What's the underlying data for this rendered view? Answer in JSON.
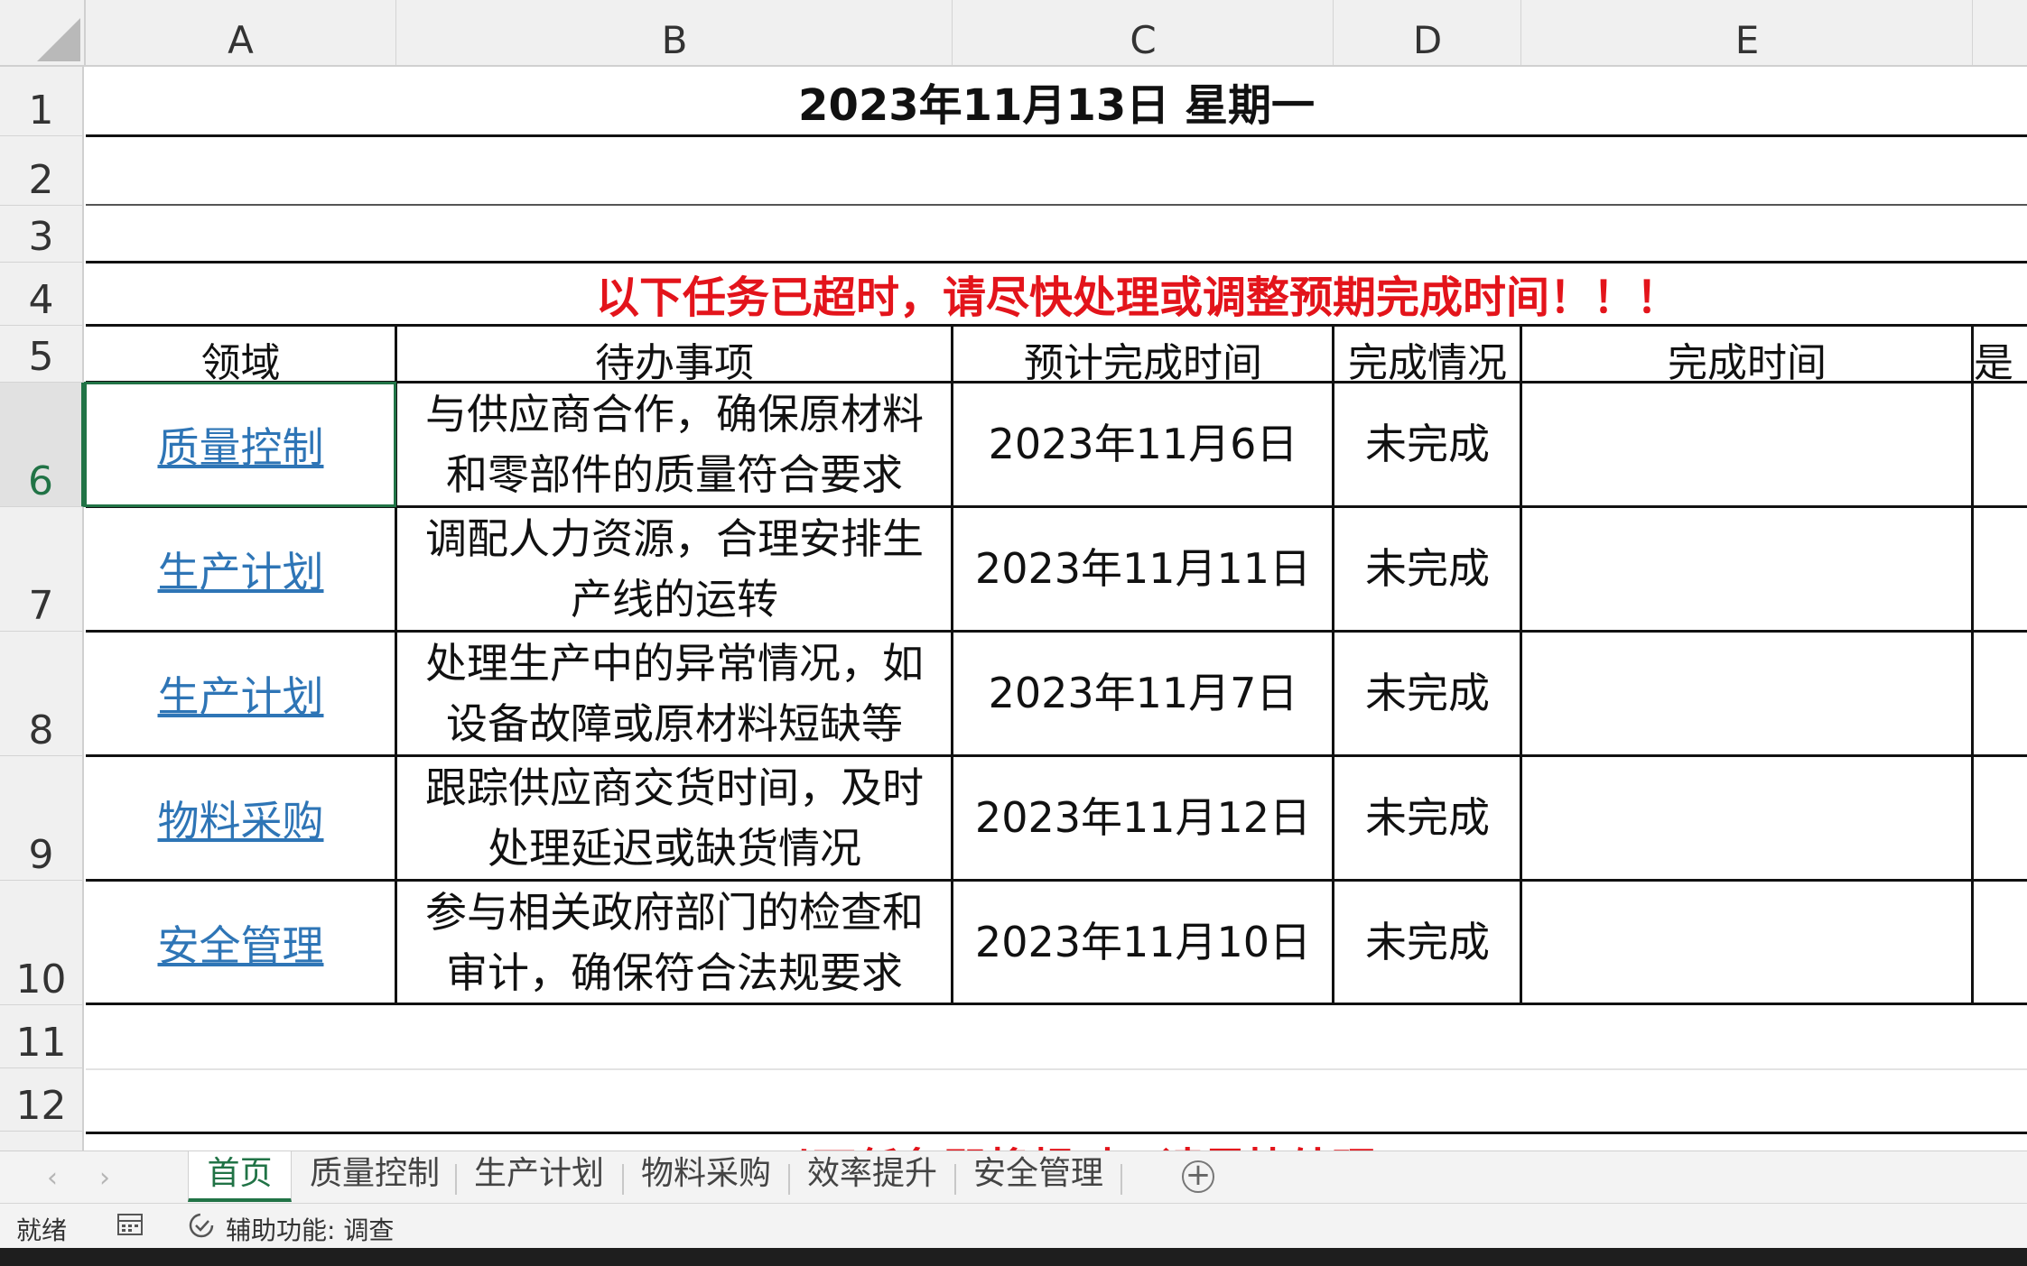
{
  "columns": [
    "A",
    "B",
    "C",
    "D",
    "E"
  ],
  "rows": [
    "1",
    "2",
    "3",
    "4",
    "5",
    "6",
    "7",
    "8",
    "9",
    "10",
    "11",
    "12"
  ],
  "sheet": {
    "title": "2023年11月13日 星期一",
    "alert": "以下任务已超时，请尽快处理或调整预期完成时间！！！",
    "headers": [
      "领域",
      "待办事项",
      "预计完成时间",
      "完成情况",
      "完成时间",
      "是"
    ],
    "tasks": [
      {
        "domain": "质量控制",
        "task_line1": "与供应商合作，确保原材料",
        "task_line2": "和零部件的质量符合要求",
        "due": "2023年11月6日",
        "status": "未完成"
      },
      {
        "domain": "生产计划",
        "task_line1": "调配人力资源，合理安排生",
        "task_line2": "产线的运转",
        "due": "2023年11月11日",
        "status": "未完成"
      },
      {
        "domain": "生产计划",
        "task_line1": "处理生产中的异常情况，如",
        "task_line2": "设备故障或原材料短缺等",
        "due": "2023年11月7日",
        "status": "未完成"
      },
      {
        "domain": "物料采购",
        "task_line1": "跟踪供应商交货时间，及时",
        "task_line2": "处理延迟或缺货情况",
        "due": "2023年11月12日",
        "status": "未完成"
      },
      {
        "domain": "安全管理",
        "task_line1": "参与相关政府部门的检查和",
        "task_line2": "审计，确保符合法规要求",
        "due": "2023年11月10日",
        "status": "未完成"
      }
    ],
    "partial_alert": "以下任务即将超时，请尽快处理！！！"
  },
  "tabs": [
    "首页",
    "质量控制",
    "生产计划",
    "物料采购",
    "效率提升",
    "安全管理"
  ],
  "active_tab": "首页",
  "nav": {
    "prev": "‹",
    "next": "›",
    "add": "+"
  },
  "status": {
    "ready": "就绪",
    "accessibility": "辅助功能: 调查"
  },
  "colors": {
    "alert": "#e3141b",
    "link": "#2e75b6",
    "accent": "#217346"
  }
}
